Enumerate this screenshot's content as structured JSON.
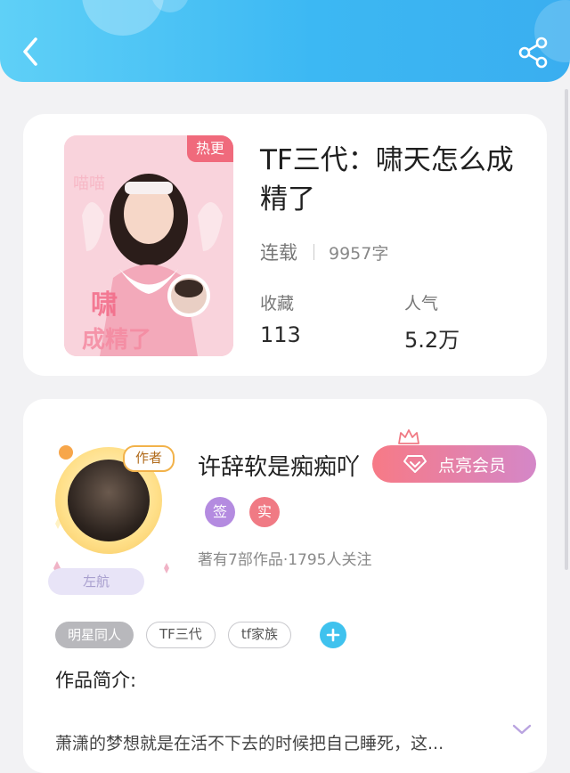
{
  "header": {
    "back_icon": "back-chevron-icon",
    "share_icon": "share-icon",
    "accent_color": "#3cb8f3"
  },
  "book": {
    "title": "TF三代：啸天怎么成精了",
    "cover_badge": "热更",
    "status": "连载",
    "word_count": "9957字",
    "stats": [
      {
        "label": "收藏",
        "value": "113"
      },
      {
        "label": "人气",
        "value": "5.2万"
      }
    ]
  },
  "author": {
    "avatar_tag": "作者",
    "name": "许辞软是痴痴吖",
    "vip_button": "点亮会员",
    "badges": [
      {
        "label": "签",
        "color": "#b48be0"
      },
      {
        "label": "实",
        "color": "#f07a84"
      }
    ],
    "works_line": "著有7部作品·1795人关注",
    "rank_label": "左航"
  },
  "tags": [
    {
      "label": "明星同人",
      "style": "filled"
    },
    {
      "label": "TF三代",
      "style": "outlined"
    },
    {
      "label": "tf家族",
      "style": "outlined"
    }
  ],
  "intro": {
    "heading": "作品简介:",
    "text": "萧潇的梦想就是在活不下去的时候把自己睡死，这..."
  }
}
